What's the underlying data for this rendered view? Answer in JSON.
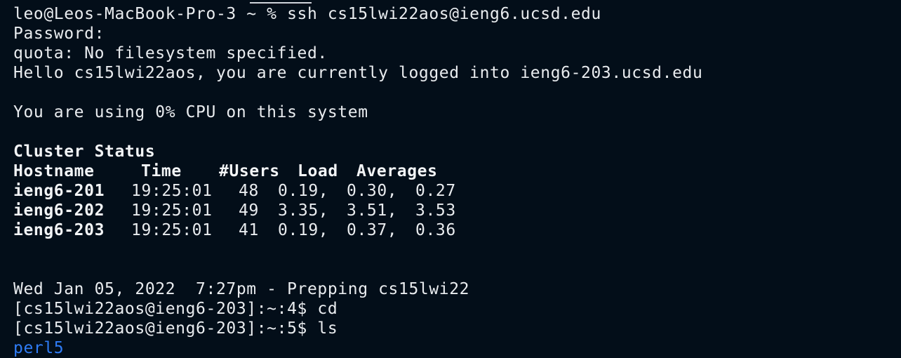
{
  "terminal": {
    "background": "#030e19",
    "foreground": "#e9ecef",
    "link_color": "#2f7cf6",
    "prompt_line": "leo@Leos-MacBook-Pro-3 ~ % ssh cs15lwi22aos@ieng6.ucsd.edu",
    "password_prompt": "Password:",
    "quota_line": "quota: No filesystem specified.",
    "hello_line": "Hello cs15lwi22aos, you are currently logged into ieng6-203.ucsd.edu",
    "cpu_line": "You are using 0% CPU on this system",
    "cluster": {
      "title": "Cluster Status",
      "headers": {
        "hostname": "Hostname",
        "time": "Time",
        "users": "#Users",
        "load": "Load",
        "averages": "Averages"
      },
      "rows": [
        {
          "host": "ieng6-201",
          "time": "19:25:01",
          "users": "48",
          "l1": "0.19,",
          "l2": "0.30,",
          "l3": "0.27"
        },
        {
          "host": "ieng6-202",
          "time": "19:25:01",
          "users": "49",
          "l1": "3.35,",
          "l2": "3.51,",
          "l3": "3.53"
        },
        {
          "host": "ieng6-203",
          "time": "19:25:01",
          "users": "41",
          "l1": "0.19,",
          "l2": "0.37,",
          "l3": "0.36"
        }
      ]
    },
    "date_line": "Wed Jan 05, 2022  7:27pm - Prepping cs15lwi22",
    "cmd_cd": "[cs15lwi22aos@ieng6-203]:~:4$ cd",
    "cmd_ls": "[cs15lwi22aos@ieng6-203]:~:5$ ls",
    "ls_output": "perl5"
  }
}
